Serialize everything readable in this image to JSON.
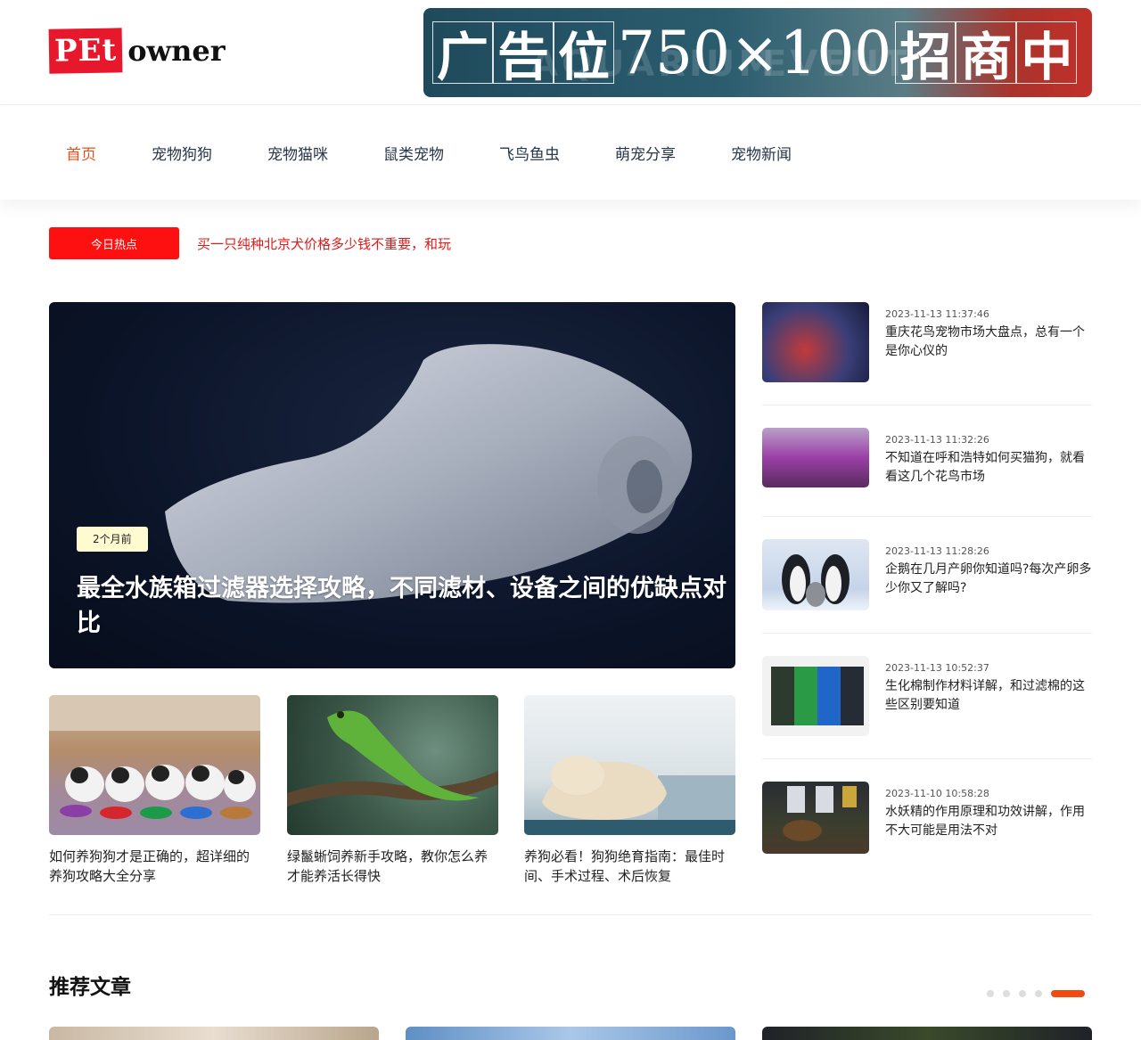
{
  "header": {
    "logo_pet": "PEt",
    "logo_owner": "owner",
    "ad_chars": [
      "广",
      "告",
      "位"
    ],
    "ad_number": "750×100",
    "ad_chars2": [
      "招",
      "商",
      "中"
    ]
  },
  "nav": {
    "items": [
      "首页",
      "宠物狗狗",
      "宠物猫咪",
      "鼠类宠物",
      "飞鸟鱼虫",
      "萌宠分享",
      "宠物新闻"
    ]
  },
  "hot": {
    "badge": "今日热点",
    "text": "买一只纯种北京犬价格多少钱不重要，和玩"
  },
  "feature": {
    "tag": "2个月前",
    "title": "最全水族箱过滤器选择攻略，不同滤材、设备之间的优缺点对比"
  },
  "cards": [
    {
      "title": "如何养狗狗才是正确的，超详细的养狗攻略大全分享"
    },
    {
      "title": "绿鬣蜥饲养新手攻略，教你怎么养才能养活长得快"
    },
    {
      "title": "养狗必看！狗狗绝育指南：最佳时间、手术过程、术后恢复"
    }
  ],
  "side": [
    {
      "date": "2023-11-13 11:37:46",
      "title": "重庆花鸟宠物市场大盘点，总有一个是你心仪的"
    },
    {
      "date": "2023-11-13 11:32:26",
      "title": "不知道在呼和浩特如何买猫狗，就看看这几个花鸟市场"
    },
    {
      "date": "2023-11-13 11:28:26",
      "title": "企鹅在几月产卵你知道吗?每次产卵多少你又了解吗?"
    },
    {
      "date": "2023-11-13 10:52:37",
      "title": "生化棉制作材料详解，和过滤棉的这些区别要知道"
    },
    {
      "date": "2023-11-10 10:58:28",
      "title": "水妖精的作用原理和功效讲解，作用不大可能是用法不对"
    }
  ],
  "recommended": {
    "title": "推荐文章"
  },
  "colors": {
    "accent": "#e8511f",
    "hot_badge": "#ff1010",
    "hot_text": "#e01b1b",
    "dot_active": "#f04b10"
  }
}
